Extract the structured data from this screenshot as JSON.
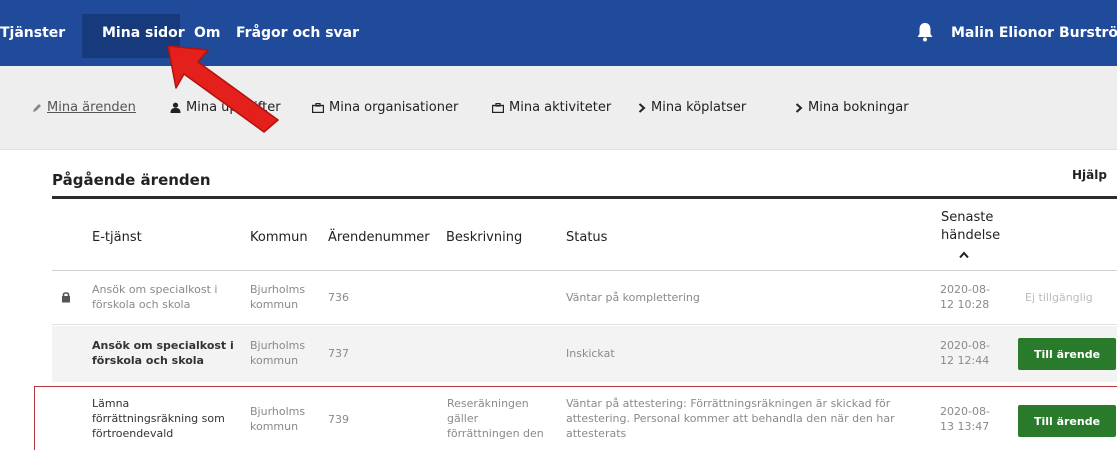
{
  "topnav": {
    "items": [
      "Tjänster",
      "Mina sidor",
      "Om",
      "Frågor och svar"
    ],
    "user": "Malin Elionor Burström",
    "bg_color": "#1f4b9a"
  },
  "subnav": {
    "items": [
      "Mina ärenden",
      "Mina uppgifter",
      "Mina organisationer",
      "Mina aktiviteter",
      "Mina köplatser",
      "Mina bokningar"
    ]
  },
  "section": {
    "title": "Pågående ärenden",
    "help": "Hjälp"
  },
  "table": {
    "headers": {
      "etjanst": "E-tjänst",
      "kommun": "Kommun",
      "arendenummer": "Ärendenummer",
      "beskrivning": "Beskrivning",
      "status": "Status",
      "senaste_1": "Senaste",
      "senaste_2": "händelse"
    },
    "rows": [
      {
        "etjanst": [
          "Ansök om specialkost i",
          "förskola och skola"
        ],
        "kommun": [
          "Bjurholms",
          "kommun"
        ],
        "nummer": "736",
        "beskrivning": [],
        "status": [
          "Väntar på komplettering"
        ],
        "datum": [
          "2020-08-",
          "12 10:28"
        ],
        "action": "Ej tillgänglig"
      },
      {
        "etjanst": [
          "Ansök om specialkost i",
          "förskola och skola"
        ],
        "kommun": [
          "Bjurholms",
          "kommun"
        ],
        "nummer": "737",
        "beskrivning": [],
        "status": [
          "Inskickat"
        ],
        "datum": [
          "2020-08-",
          "12 12:44"
        ],
        "action": "Till ärende"
      },
      {
        "etjanst": [
          "Lämna",
          "förrättningsräkning som",
          "förtroendevald"
        ],
        "kommun": [
          "Bjurholms",
          "kommun"
        ],
        "nummer": "739",
        "beskrivning": [
          "Reseräkningen",
          "gäller",
          "förrättningen den"
        ],
        "status": [
          "Väntar på attestering: Förrättningsräkningen är skickad för",
          "attestering. Personal kommer att behandla den när den har",
          "attesterats"
        ],
        "datum": [
          "2020-08-",
          "13 13:47"
        ],
        "action": "Till ärende"
      }
    ]
  },
  "colors": {
    "nav": "#1f4b9a",
    "nav_active": "#163a7c",
    "button": "#2a7a2b",
    "highlight_border": "#b5373b",
    "arrow": "#e3201b"
  },
  "icons": {
    "bell": "bell-icon",
    "lock": "lock-icon",
    "person": "person-icon",
    "briefcase": "briefcase-icon",
    "chevron": "chevron-right-icon",
    "sort": "caret-up-icon",
    "arrow": "red-arrow-annotation"
  }
}
